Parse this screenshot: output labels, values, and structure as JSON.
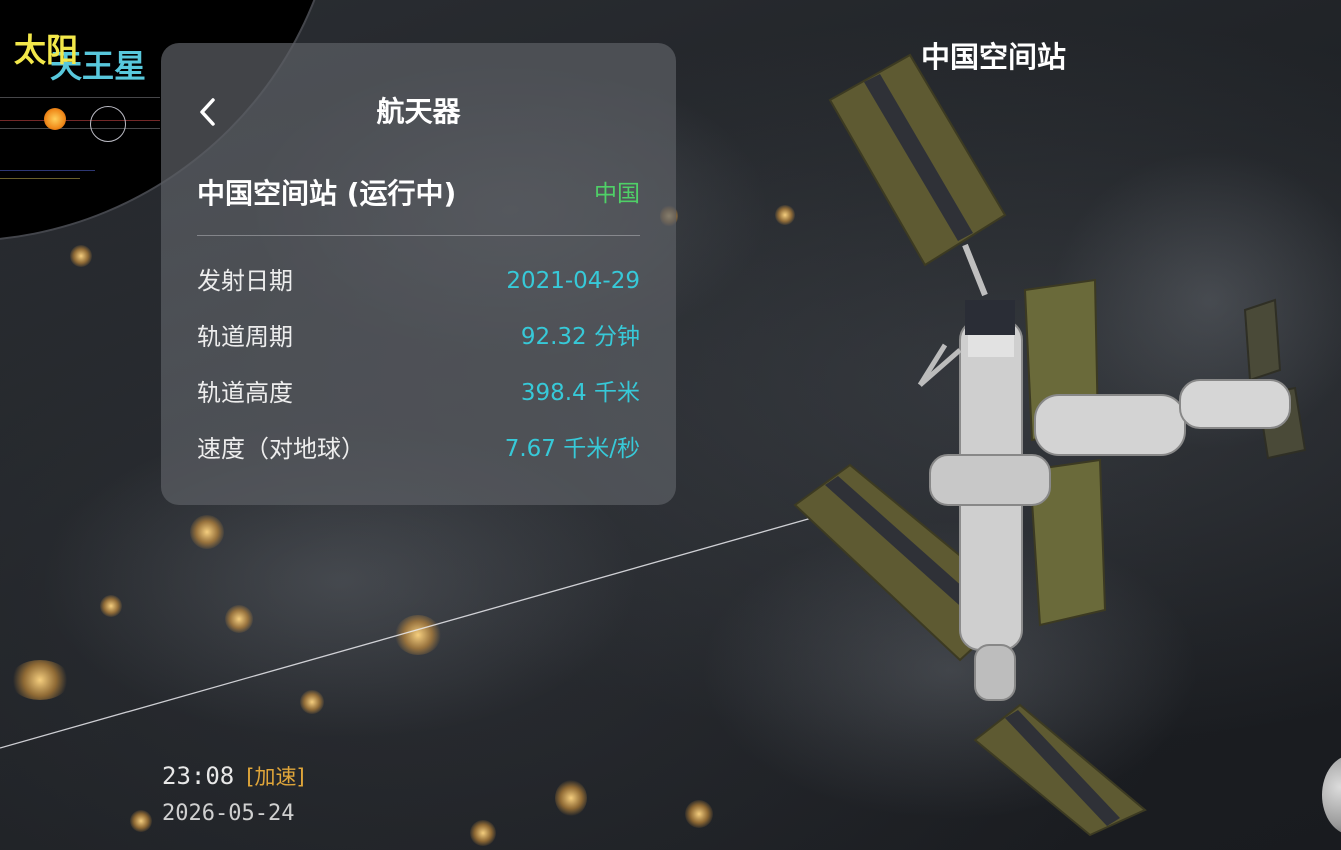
{
  "sky_labels": {
    "sun": "太阳",
    "uranus": "天王星"
  },
  "station_label": "中国空间站",
  "panel": {
    "title": "航天器",
    "back_icon": "chevron-left-icon",
    "craft_name": "中国空间站 (运行中)",
    "country": "中国",
    "rows": [
      {
        "label": "发射日期",
        "value": "2021-04-29"
      },
      {
        "label": "轨道周期",
        "value": "92.32 分钟"
      },
      {
        "label": "轨道高度",
        "value": "398.4 千米"
      },
      {
        "label": "速度（对地球）",
        "value": "7.67 千米/秒"
      }
    ]
  },
  "status": {
    "time": "23:08",
    "speed_mode": "[加速]",
    "date": "2026-05-24"
  },
  "colors": {
    "value_cyan": "#37c9d8",
    "country_green": "#4fd067",
    "speed_orange": "#e0a63a",
    "sun_yellow": "#f3e84a",
    "uranus_cyan": "#58c8dc"
  }
}
